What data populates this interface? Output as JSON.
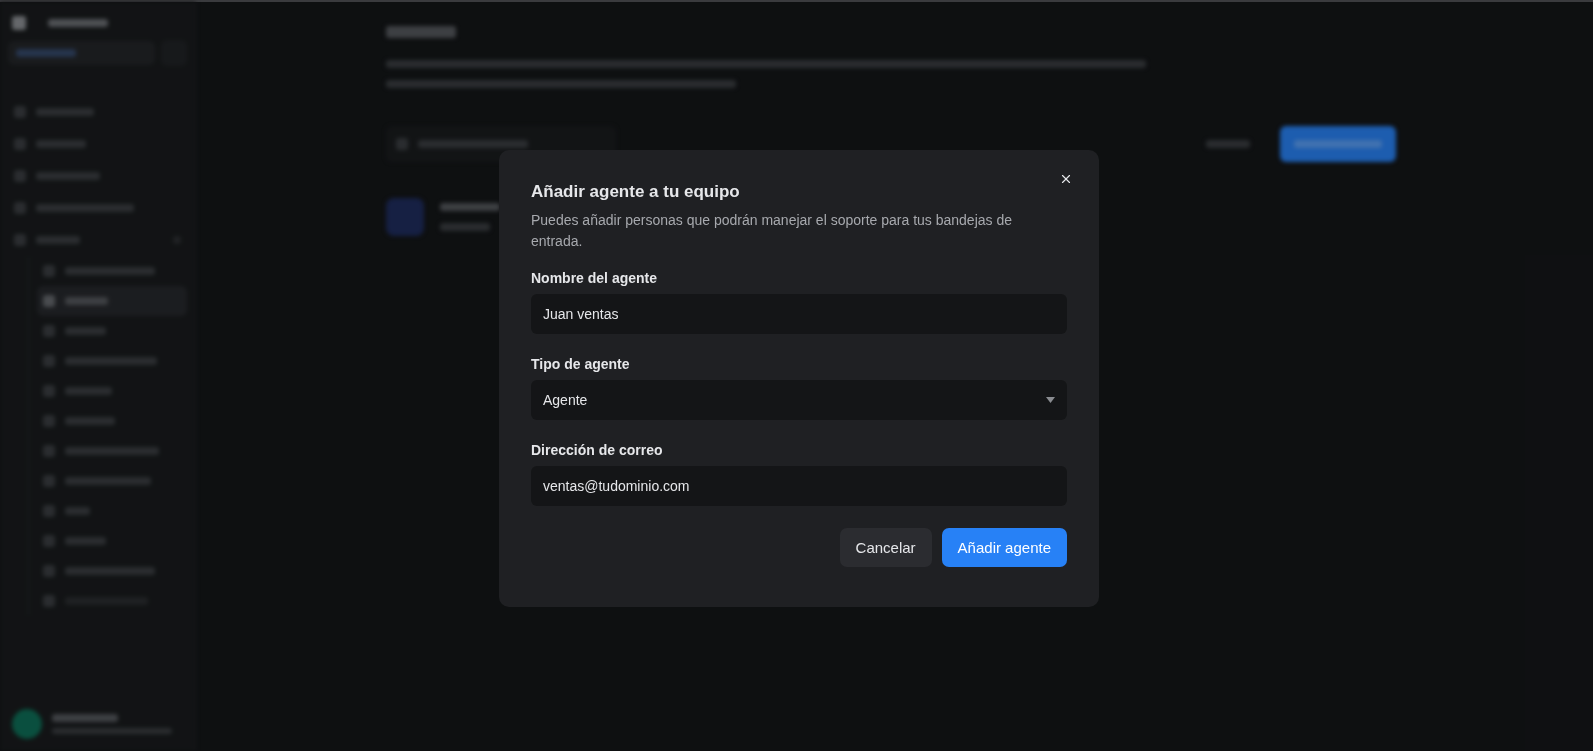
{
  "dialog": {
    "title": "Añadir agente a tu equipo",
    "description": "Puedes añadir personas que podrán manejar el soporte para tus bandejas de entrada.",
    "fields": [
      {
        "kind": "text",
        "label": "Nombre del agente",
        "value": "Juan ventas"
      },
      {
        "kind": "select",
        "label": "Tipo de agente",
        "value": "Agente"
      },
      {
        "kind": "text",
        "label": "Dirección de correo",
        "value": "ventas@tudominio.com"
      }
    ],
    "buttons": [
      {
        "label": "Cancelar",
        "kind": "secondary"
      },
      {
        "label": "Añadir agente",
        "kind": "primary"
      }
    ]
  }
}
